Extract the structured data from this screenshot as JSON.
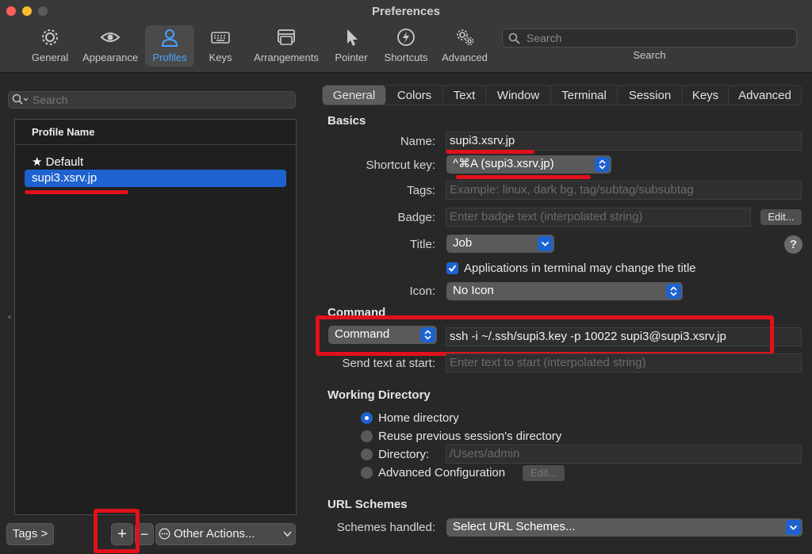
{
  "window": {
    "title": "Preferences"
  },
  "toolbar": {
    "items": [
      {
        "label": "General",
        "icon": "gear-icon"
      },
      {
        "label": "Appearance",
        "icon": "eye-icon"
      },
      {
        "label": "Profiles",
        "icon": "person-icon"
      },
      {
        "label": "Keys",
        "icon": "keyboard-icon"
      },
      {
        "label": "Arrangements",
        "icon": "window-icon"
      },
      {
        "label": "Pointer",
        "icon": "pointer-icon"
      },
      {
        "label": "Shortcuts",
        "icon": "bolt-icon"
      },
      {
        "label": "Advanced",
        "icon": "gears-icon"
      }
    ],
    "search_placeholder": "Search",
    "search_label": "Search"
  },
  "sidebar": {
    "search_placeholder": "Search",
    "column_header": "Profile Name",
    "profiles": [
      "★ Default",
      "supi3.xsrv.jp"
    ],
    "tags_button": "Tags >",
    "add_button": "+",
    "remove_button": "−",
    "other_actions": "Other Actions..."
  },
  "tabs": [
    "General",
    "Colors",
    "Text",
    "Window",
    "Terminal",
    "Session",
    "Keys",
    "Advanced"
  ],
  "basics": {
    "heading": "Basics",
    "name_label": "Name:",
    "name_value": "supi3.xsrv.jp",
    "shortcut_label": "Shortcut key:",
    "shortcut_value": "^⌘A (supi3.xsrv.jp)",
    "tags_label": "Tags:",
    "tags_placeholder": "Example: linux, dark bg, tag/subtag/subsubtag",
    "badge_label": "Badge:",
    "badge_placeholder": "Enter badge text (interpolated string)",
    "badge_edit": "Edit...",
    "title_label": "Title:",
    "title_value": "Job",
    "help": "?",
    "apps_change_title": "Applications in terminal may change the title",
    "icon_label": "Icon:",
    "icon_value": "No Icon"
  },
  "command": {
    "heading": "Command",
    "type_value": "Command",
    "command_value": "ssh -i ~/.ssh/supi3.key -p 10022 supi3@supi3.xsrv.jp",
    "send_text_label": "Send text at start:",
    "send_text_placeholder": "Enter text to start (interpolated string)"
  },
  "working_directory": {
    "heading": "Working Directory",
    "options": [
      "Home directory",
      "Reuse previous session's directory",
      "Directory:",
      "Advanced Configuration"
    ],
    "selected_index": 0,
    "directory_placeholder": "/Users/admin",
    "advanced_edit": "Edit..."
  },
  "url_schemes": {
    "heading": "URL Schemes",
    "label": "Schemes handled:",
    "value": "Select URL Schemes..."
  },
  "colors": {
    "accent": "#1e62d0",
    "highlight": "#e0111a",
    "active_toolbar": "#4aa3ff"
  }
}
